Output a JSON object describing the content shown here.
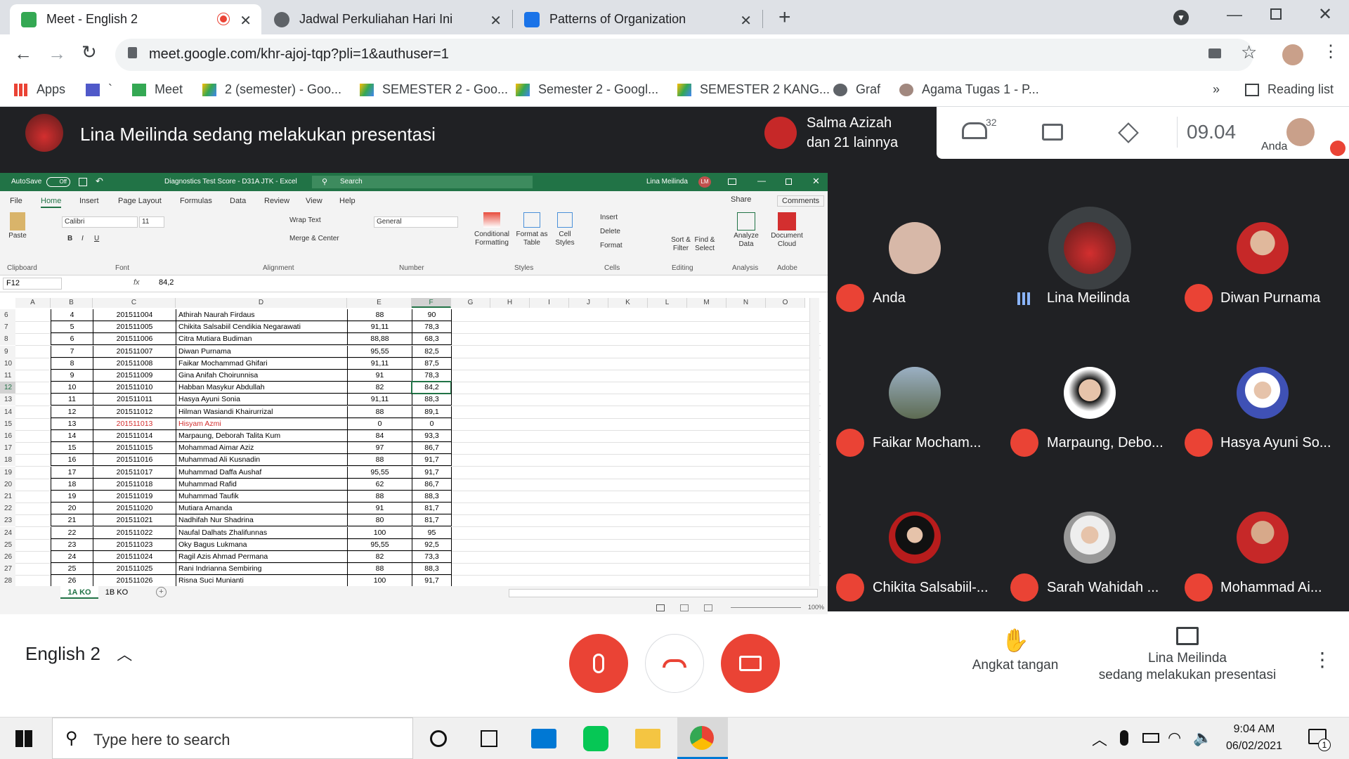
{
  "browser": {
    "tabs": [
      {
        "title": "Meet - English 2",
        "fav": "#34a853"
      },
      {
        "title": "Jadwal Perkuliahan Hari Ini",
        "fav": "#5f6368"
      },
      {
        "title": "Patterns of Organization",
        "fav": "#1a73e8"
      }
    ],
    "new_tab": "+",
    "url": "meet.google.com/khr-ajoj-tqp?pli=1&authuser=1",
    "bookmarks": [
      "Apps",
      "`",
      "Meet",
      "2 (semester) - Goo...",
      "SEMESTER 2 - Goo...",
      "Semester 2 - Googl...",
      "SEMESTER 2 KANG...",
      "Graf",
      "Agama Tugas 1 - P..."
    ],
    "bookmarks_more": "»",
    "reading_list": "Reading list"
  },
  "meet": {
    "presenter_text": "Lina Meilinda sedang melakukan presentasi",
    "participant_preview": {
      "name": "Salma Azizah",
      "more": "dan 21 lainnya"
    },
    "people_count": "32",
    "clock": "09.04",
    "self_label": "Anda",
    "tiles": [
      {
        "name": "Anda",
        "muted": true
      },
      {
        "name": "Lina Meilinda",
        "muted": false
      },
      {
        "name": "Diwan Purnama",
        "muted": true
      },
      {
        "name": "Faikar Mocham...",
        "muted": true
      },
      {
        "name": "Marpaung, Debo...",
        "muted": true
      },
      {
        "name": "Hasya Ayuni So...",
        "muted": true
      },
      {
        "name": "Chikita Salsabiil-...",
        "muted": true
      },
      {
        "name": "Sarah Wahidah ...",
        "muted": true
      },
      {
        "name": "Mohammad Ai...",
        "muted": true
      }
    ],
    "meeting_name": "English 2",
    "raise_hand": "Angkat tangan",
    "presenting_line1": "Lina Meilinda",
    "presenting_line2": "sedang melakukan presentasi"
  },
  "excel": {
    "autosave": "AutoSave",
    "autosave_state": "Off",
    "doc_title": "Diagnostics Test Score - D31A JTK  -  Excel",
    "search": "Search",
    "user": "Lina Meilinda",
    "user_initials": "LM",
    "tabs": [
      "File",
      "Home",
      "Insert",
      "Page Layout",
      "Formulas",
      "Data",
      "Review",
      "View",
      "Help"
    ],
    "share": "Share",
    "comments": "Comments",
    "font": "Calibri",
    "font_size": "11",
    "number_format": "General",
    "wrap": "Wrap Text",
    "merge": "Merge & Center",
    "groups": [
      "Clipboard",
      "Font",
      "Alignment",
      "Number",
      "Styles",
      "Cells",
      "Editing",
      "Analysis",
      "Adobe"
    ],
    "buttons": {
      "paste": "Paste",
      "cond": "Conditional Formatting",
      "fmt_table": "Format as Table",
      "cell_styles": "Cell Styles",
      "insert": "Insert",
      "delete": "Delete",
      "format": "Format",
      "sort": "Sort & Filter",
      "find": "Find & Select",
      "analyze": "Analyze Data",
      "doc_cloud": "Document Cloud"
    },
    "namebox": "F12",
    "formula": "84,2",
    "fx": "fx",
    "columns": [
      "A",
      "B",
      "C",
      "D",
      "E",
      "F",
      "G",
      "H",
      "I",
      "J",
      "K",
      "L",
      "M",
      "N",
      "O"
    ],
    "rows": [
      {
        "r": "6",
        "no": "4",
        "nim": "201511004",
        "name": "Athirah Naurah Firdaus",
        "e": "88",
        "f": "90"
      },
      {
        "r": "7",
        "no": "5",
        "nim": "201511005",
        "name": "Chikita Salsabiil Cendikia Negarawati",
        "e": "91,11",
        "f": "78,3"
      },
      {
        "r": "8",
        "no": "6",
        "nim": "201511006",
        "name": "Citra Mutiara Budiman",
        "e": "88,88",
        "f": "68,3"
      },
      {
        "r": "9",
        "no": "7",
        "nim": "201511007",
        "name": "Diwan Purnama",
        "e": "95,55",
        "f": "82,5"
      },
      {
        "r": "10",
        "no": "8",
        "nim": "201511008",
        "name": "Faikar Mochammad Ghifari",
        "e": "91,11",
        "f": "87,5"
      },
      {
        "r": "11",
        "no": "9",
        "nim": "201511009",
        "name": "Gina Anifah Choirunnisa",
        "e": "91",
        "f": "78,3"
      },
      {
        "r": "12",
        "no": "10",
        "nim": "201511010",
        "name": "Habban Masykur Abdullah",
        "e": "82",
        "f": "84,2"
      },
      {
        "r": "13",
        "no": "11",
        "nim": "201511011",
        "name": "Hasya Ayuni Sonia",
        "e": "91,11",
        "f": "88,3"
      },
      {
        "r": "14",
        "no": "12",
        "nim": "201511012",
        "name": "Hilman Wasiandi Khairurrizal",
        "e": "88",
        "f": "89,1"
      },
      {
        "r": "15",
        "no": "13",
        "nim": "201511013",
        "name": "Hisyam Azmi",
        "e": "0",
        "f": "0",
        "red": true
      },
      {
        "r": "16",
        "no": "14",
        "nim": "201511014",
        "name": "Marpaung, Deborah Talita Kum",
        "e": "84",
        "f": "93,3"
      },
      {
        "r": "17",
        "no": "15",
        "nim": "201511015",
        "name": "Mohammad Aimar Aziz",
        "e": "97",
        "f": "86,7"
      },
      {
        "r": "18",
        "no": "16",
        "nim": "201511016",
        "name": "Muhammad Ali Kusnadin",
        "e": "88",
        "f": "91,7"
      },
      {
        "r": "19",
        "no": "17",
        "nim": "201511017",
        "name": "Muhammad Daffa Aushaf",
        "e": "95,55",
        "f": "91,7"
      },
      {
        "r": "20",
        "no": "18",
        "nim": "201511018",
        "name": "Muhammad Rafid",
        "e": "62",
        "f": "86,7"
      },
      {
        "r": "21",
        "no": "19",
        "nim": "201511019",
        "name": "Muhammad Taufik",
        "e": "88",
        "f": "88,3"
      },
      {
        "r": "22",
        "no": "20",
        "nim": "201511020",
        "name": "Mutiara Amanda",
        "e": "91",
        "f": "81,7"
      },
      {
        "r": "23",
        "no": "21",
        "nim": "201511021",
        "name": "Nadhifah Nur Shadrina",
        "e": "80",
        "f": "81,7"
      },
      {
        "r": "24",
        "no": "22",
        "nim": "201511022",
        "name": "Naufal Dalhats Zhalifunnas",
        "e": "100",
        "f": "95"
      },
      {
        "r": "25",
        "no": "23",
        "nim": "201511023",
        "name": "Oky Bagus Lukmana",
        "e": "95,55",
        "f": "92,5"
      },
      {
        "r": "26",
        "no": "24",
        "nim": "201511024",
        "name": "Ragil Azis Ahmad Permana",
        "e": "82",
        "f": "73,3"
      },
      {
        "r": "27",
        "no": "25",
        "nim": "201511025",
        "name": "Rani Indrianna Sembiring",
        "e": "88",
        "f": "88,3"
      },
      {
        "r": "28",
        "no": "26",
        "nim": "201511026",
        "name": "Risna Suci Munianti",
        "e": "100",
        "f": "91,7"
      }
    ],
    "sheets": [
      "1A KO",
      "1B KO"
    ],
    "zoom": "100%"
  },
  "taskbar": {
    "search": "Type here to search",
    "time": "9:04 AM",
    "date": "06/02/2021",
    "notif": "1"
  }
}
